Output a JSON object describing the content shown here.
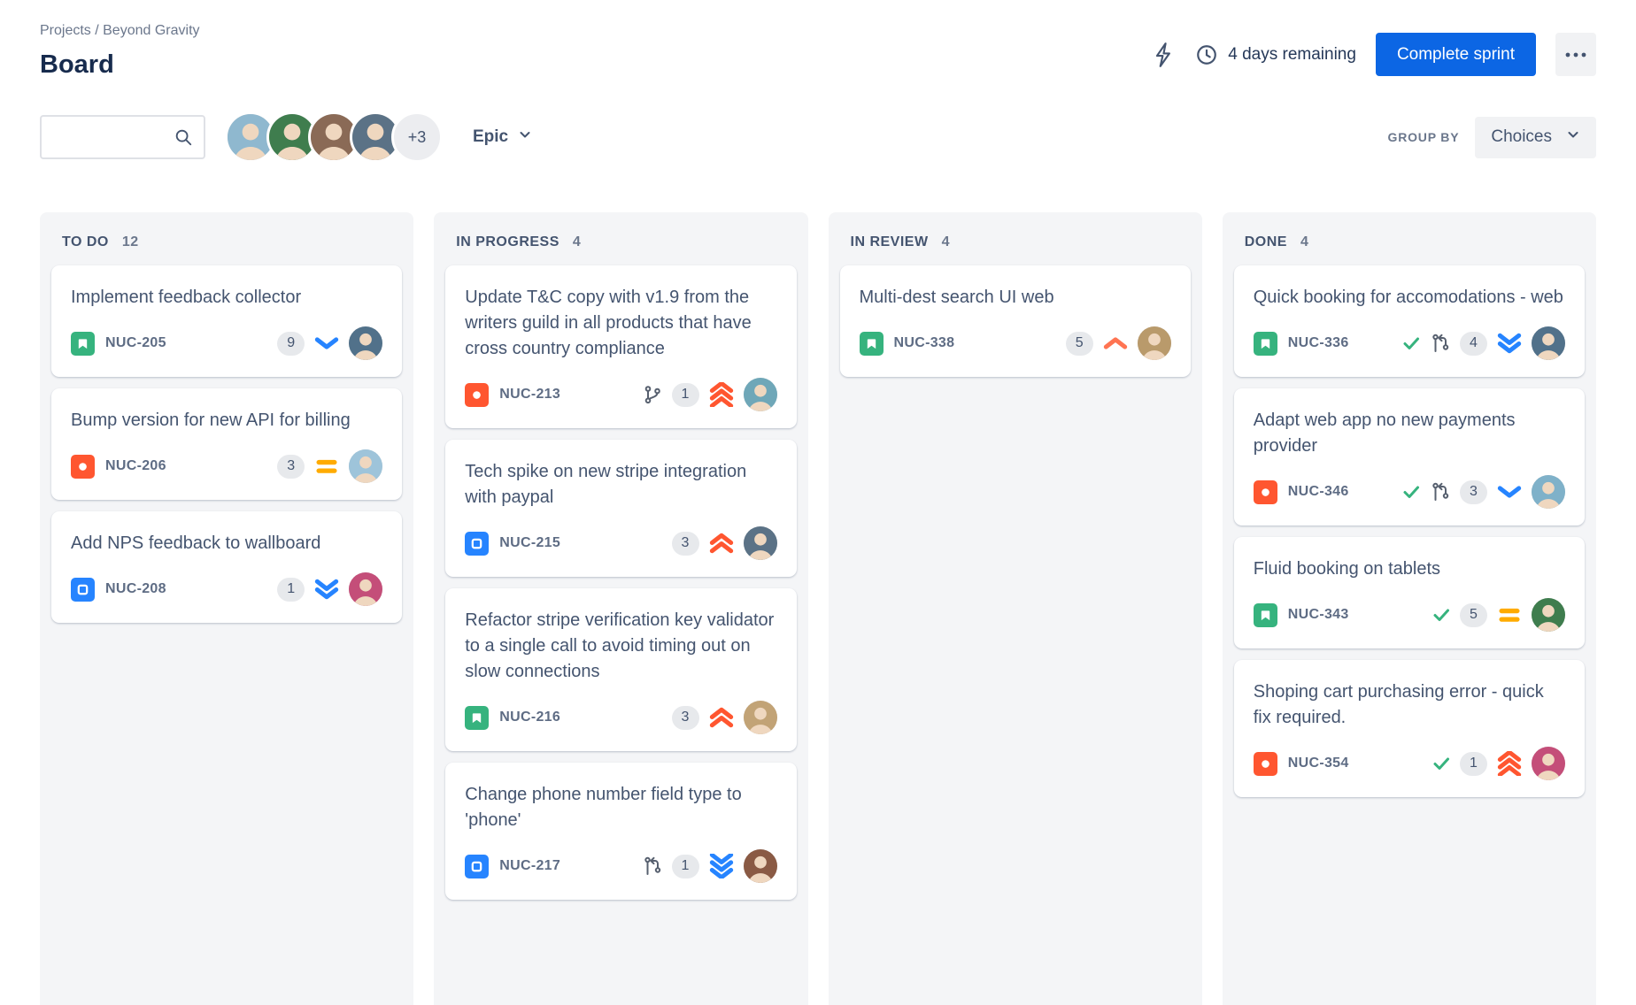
{
  "breadcrumb": "Projects / Beyond Gravity",
  "page_title": "Board",
  "header": {
    "days_remaining": "4 days remaining",
    "complete_sprint_label": "Complete sprint"
  },
  "search": {
    "placeholder": ""
  },
  "toolbar": {
    "avatar_overflow": "+3",
    "avatars": [
      {
        "label": "team-member-1",
        "color": "#8FB8CF"
      },
      {
        "label": "team-member-2",
        "color": "#3F7D4E"
      },
      {
        "label": "team-member-3",
        "color": "#8A6A56"
      },
      {
        "label": "team-member-4",
        "color": "#5B7286"
      }
    ],
    "epic_filter_label": "Epic",
    "group_by_label": "GROUP BY",
    "group_by_value": "Choices"
  },
  "icons": {
    "search_icon": "magnifier",
    "lightning_icon": "lightning-bolt-outline",
    "clock_icon": "clock-outline",
    "more_icon": "horizontal-ellipsis",
    "chevron_icon": "chevron-down",
    "story_icon": "green square with white bookmark",
    "bug_icon": "red square with white circle",
    "task_icon": "blue square with white square outline",
    "branch_icon": "git-branch",
    "pull_request_icon": "git-pull-request",
    "check_icon": "green checkmark"
  },
  "colors": {
    "accent_button": "#0C66E4",
    "column_bg": "#F4F5F7",
    "card_bg": "#FFFFFF",
    "story": "#36B37E",
    "bug": "#FF5630",
    "task": "#2684FF",
    "priority_up": "#FF5630",
    "priority_up_single": "#FF7452",
    "priority_down": "#2684FF",
    "priority_medium": "#FFAB00",
    "text_primary": "#172B4D",
    "text_secondary": "#44546F",
    "text_muted": "#6B778C",
    "badge_bg": "#E7E9EC"
  },
  "columns": [
    {
      "title": "TO DO",
      "count": "12",
      "cards": [
        {
          "title": "Implement feedback collector",
          "key": "NUC-205",
          "type": "story",
          "estimate": "9",
          "priority": "low",
          "avatar_color": "#51718A"
        },
        {
          "title": "Bump version for new API for billing",
          "key": "NUC-206",
          "type": "bug",
          "estimate": "3",
          "priority": "medium",
          "avatar_color": "#9EC4DA"
        },
        {
          "title": "Add NPS feedback to wallboard",
          "key": "NUC-208",
          "type": "task",
          "estimate": "1",
          "priority": "lower",
          "avatar_color": "#C44E79"
        }
      ]
    },
    {
      "title": "IN PROGRESS",
      "count": "4",
      "cards": [
        {
          "title": "Update T&C copy with v1.9 from the writers guild in all products that have cross country compliance",
          "key": "NUC-213",
          "type": "bug",
          "estimate": "1",
          "priority": "highest",
          "dev_icon": "branch",
          "avatar_color": "#6FA7B8"
        },
        {
          "title": "Tech spike on new stripe integration with paypal",
          "key": "NUC-215",
          "type": "task",
          "estimate": "3",
          "priority": "higher",
          "avatar_color": "#5B7286"
        },
        {
          "title": "Refactor stripe verification key validator to a single call to avoid timing out on slow connections",
          "key": "NUC-216",
          "type": "story",
          "estimate": "3",
          "priority": "higher",
          "avatar_color": "#C2A376"
        },
        {
          "title": "Change phone number field type to 'phone'",
          "key": "NUC-217",
          "type": "task",
          "estimate": "1",
          "priority": "lowest",
          "dev_icon": "pull-request",
          "avatar_color": "#8A5A44"
        }
      ]
    },
    {
      "title": "IN REVIEW",
      "count": "4",
      "cards": [
        {
          "title": "Multi-dest search UI web",
          "key": "NUC-338",
          "type": "story",
          "estimate": "5",
          "priority": "high",
          "avatar_color": "#B99A6B"
        }
      ]
    },
    {
      "title": "DONE",
      "count": "4",
      "cards": [
        {
          "title": "Quick booking for accomodations - web",
          "key": "NUC-336",
          "type": "story",
          "estimate": "4",
          "priority": "lower",
          "dev_icon": "pull-request",
          "done_check": true,
          "avatar_color": "#51718A"
        },
        {
          "title": "Adapt web app no new payments provider",
          "key": "NUC-346",
          "type": "bug",
          "estimate": "3",
          "priority": "low",
          "dev_icon": "pull-request",
          "done_check": true,
          "avatar_color": "#7FB1C9"
        },
        {
          "title": "Fluid booking on tablets",
          "key": "NUC-343",
          "type": "story",
          "estimate": "5",
          "priority": "medium",
          "done_check": true,
          "avatar_color": "#3F7D4E"
        },
        {
          "title": "Shoping cart purchasing error - quick fix required.",
          "key": "NUC-354",
          "type": "bug",
          "estimate": "1",
          "priority": "highest",
          "done_check": true,
          "avatar_color": "#C44E79"
        }
      ]
    }
  ]
}
